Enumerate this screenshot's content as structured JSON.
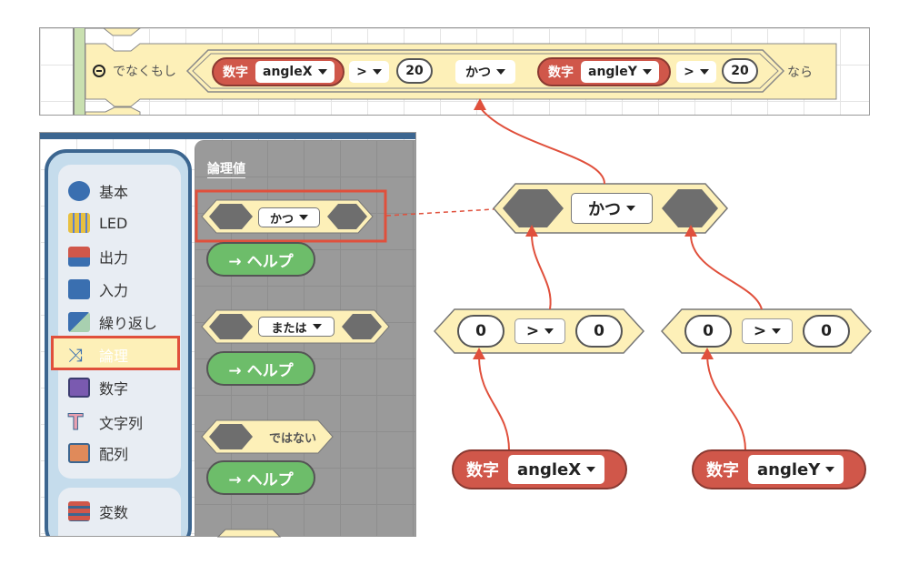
{
  "top_block": {
    "else_if_label": "でなくもし",
    "then_label": "なら",
    "left_cond": {
      "type_label": "数字",
      "variable": "angleX",
      "operator": ">",
      "value": "20"
    },
    "logic_op": "かつ",
    "right_cond": {
      "type_label": "数字",
      "variable": "angleY",
      "operator": ">",
      "value": "20"
    }
  },
  "sidebar": {
    "items": [
      {
        "label": "基本",
        "color": "#3a6fb0"
      },
      {
        "label": "LED",
        "color": "#5a7fd0"
      },
      {
        "label": "出力",
        "color": "#d0574a"
      },
      {
        "label": "入力",
        "color": "#3a6fb0"
      },
      {
        "label": "繰り返し",
        "color": "#6fb7a0"
      },
      {
        "label": "論理",
        "color": "#3a6fb0"
      },
      {
        "label": "数字",
        "color": "#7a5ab0"
      },
      {
        "label": "文字列",
        "color": "#e8a0b0"
      },
      {
        "label": "配列",
        "color": "#e08a5a"
      },
      {
        "label": "変数",
        "color": "#d0574a"
      }
    ],
    "selected": "論理"
  },
  "flyout": {
    "heading": "論理値",
    "blocks": [
      {
        "label": "かつ",
        "help": "→ ヘルプ"
      },
      {
        "label": "または",
        "help": "→ ヘルプ"
      },
      {
        "label": "ではない",
        "help": "→ ヘルプ"
      }
    ]
  },
  "diagram": {
    "and_block": "かつ",
    "compare_left": {
      "a": "0",
      "op": ">",
      "b": "0"
    },
    "compare_right": {
      "a": "0",
      "op": ">",
      "b": "0"
    },
    "var_left": {
      "type_label": "数字",
      "variable": "angleX"
    },
    "var_right": {
      "type_label": "数字",
      "variable": "angleY"
    }
  },
  "colors": {
    "logic": "#fdf0b8",
    "number": "#d0574a",
    "help": "#6dbd6a",
    "highlight": "#e0503c",
    "loops_green": "#c9e0b0"
  }
}
